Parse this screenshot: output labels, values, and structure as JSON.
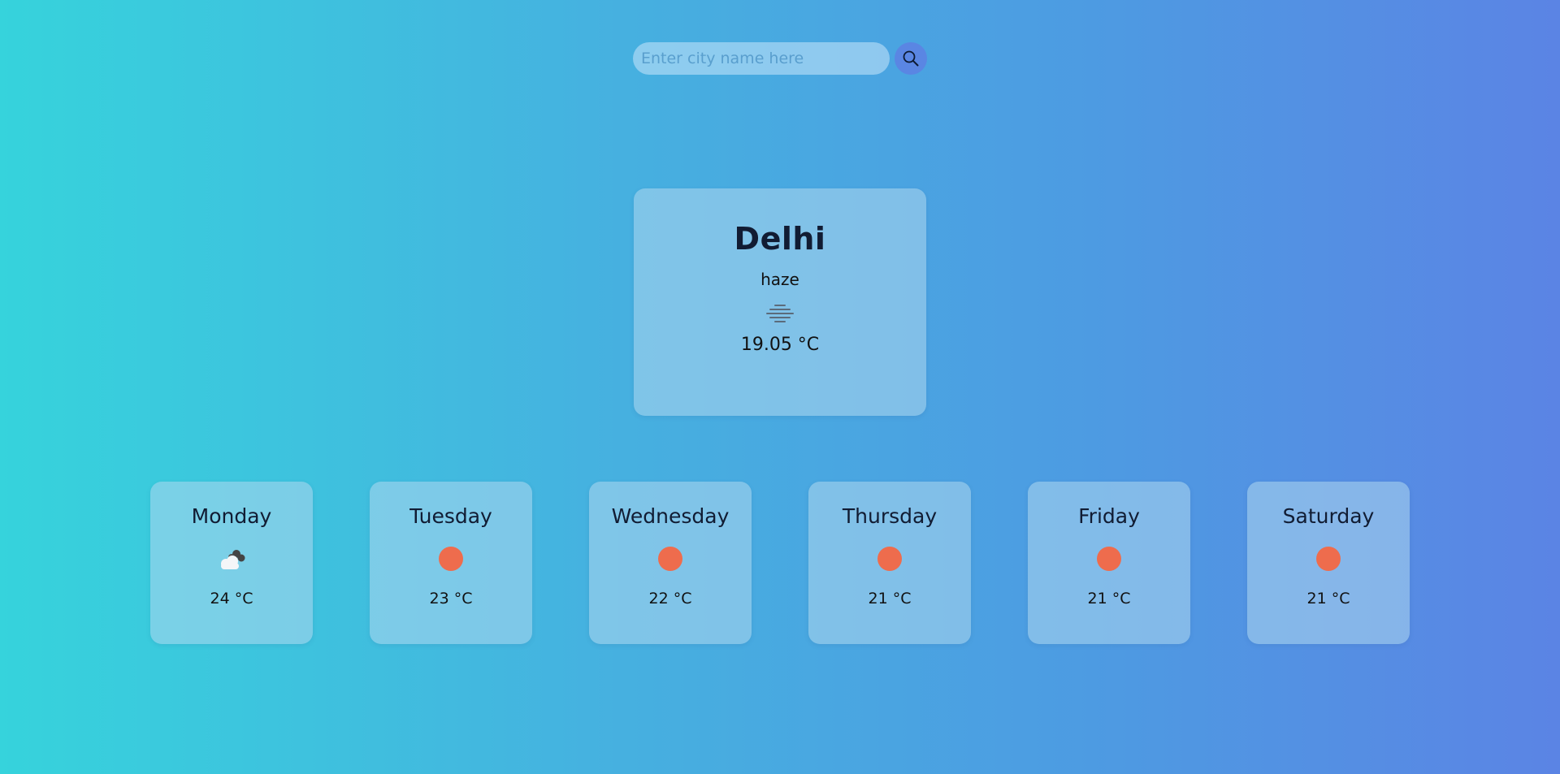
{
  "search": {
    "placeholder": "Enter city name here",
    "button_icon": "search-icon"
  },
  "current": {
    "city": "Delhi",
    "condition": "haze",
    "icon": "haze-icon",
    "temperature": "19.05 °C"
  },
  "forecast": [
    {
      "day": "Monday",
      "icon": "partly-cloudy-icon",
      "temperature": "24 °C"
    },
    {
      "day": "Tuesday",
      "icon": "sun-icon",
      "temperature": "23 °C"
    },
    {
      "day": "Wednesday",
      "icon": "sun-icon",
      "temperature": "22 °C"
    },
    {
      "day": "Thursday",
      "icon": "sun-icon",
      "temperature": "21 °C"
    },
    {
      "day": "Friday",
      "icon": "sun-icon",
      "temperature": "21 °C"
    },
    {
      "day": "Saturday",
      "icon": "sun-icon",
      "temperature": "21 °C"
    }
  ],
  "colors": {
    "sun": "#ee6c4d",
    "accent": "#5a86e3"
  }
}
